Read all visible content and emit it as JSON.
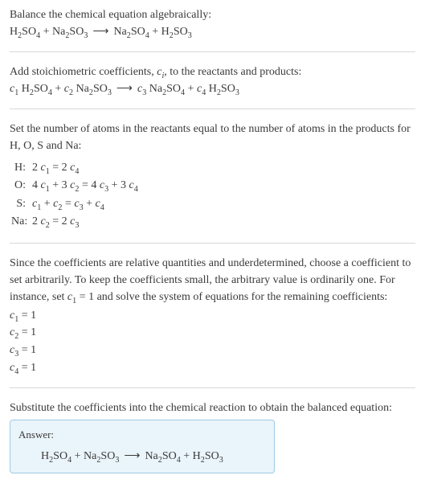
{
  "intro": {
    "line1": "Balance the chemical equation algebraically:",
    "eq_lhs1": "H",
    "eq_lhs2": "2",
    "eq_lhs3": "SO",
    "eq_lhs4": "4",
    "plus1": " + ",
    "eq_lhs5": "Na",
    "eq_lhs6": "2",
    "eq_lhs7": "SO",
    "eq_lhs8": "3",
    "arrow": "⟶",
    "eq_rhs1": "Na",
    "eq_rhs2": "2",
    "eq_rhs3": "SO",
    "eq_rhs4": "4",
    "plus2": " + ",
    "eq_rhs5": "H",
    "eq_rhs6": "2",
    "eq_rhs7": "SO",
    "eq_rhs8": "3"
  },
  "step_coeffs": {
    "text1": "Add stoichiometric coefficients, ",
    "ci_c": "c",
    "ci_i": "i",
    "text2": ", to the reactants and products:",
    "c1": "c",
    "s1": "1",
    "sp1": " H",
    "s1b": "2",
    "sp1b": "SO",
    "s1c": "4",
    "plus1": " + ",
    "c2": "c",
    "s2": "2",
    "sp2": " Na",
    "s2b": "2",
    "sp2b": "SO",
    "s2c": "3",
    "arrow": "⟶",
    "c3": "c",
    "s3": "3",
    "sp3": " Na",
    "s3b": "2",
    "sp3b": "SO",
    "s3c": "4",
    "plus2": " + ",
    "c4": "c",
    "s4": "4",
    "sp4": " H",
    "s4b": "2",
    "sp4b": "SO",
    "s4c": "3"
  },
  "step_atoms": {
    "text": "Set the number of atoms in the reactants equal to the number of atoms in the products for H, O, S and Na:",
    "rows": {
      "H_label": "H:",
      "H_eq_a": "2 ",
      "H_c1": "c",
      "H_s1": "1",
      "H_mid": " = 2 ",
      "H_c4": "c",
      "H_s4": "4",
      "O_label": "O:",
      "O_a": "4 ",
      "O_c1": "c",
      "O_s1": "1",
      "O_b": " + 3 ",
      "O_c2": "c",
      "O_s2": "2",
      "O_c": " = 4 ",
      "O_c3": "c",
      "O_s3": "3",
      "O_d": " + 3 ",
      "O_c4": "c",
      "O_s4": "4",
      "S_label": "S:",
      "S_c1": "c",
      "S_s1": "1",
      "S_a": " + ",
      "S_c2": "c",
      "S_s2": "2",
      "S_b": " = ",
      "S_c3": "c",
      "S_s3": "3",
      "S_c": " + ",
      "S_c4": "c",
      "S_s4": "4",
      "Na_label": "Na:",
      "Na_a": "2 ",
      "Na_c2": "c",
      "Na_s2": "2",
      "Na_b": " = 2 ",
      "Na_c3": "c",
      "Na_s3": "3"
    }
  },
  "step_solve": {
    "text_a": "Since the coefficients are relative quantities and underdetermined, choose a coefficient to set arbitrarily. To keep the coefficients small, the arbitrary value is ordinarily one. For instance, set ",
    "set_c": "c",
    "set_s": "1",
    "set_eq": " = 1",
    "text_b": " and solve the system of equations for the remaining coefficients:",
    "c1c": "c",
    "c1s": "1",
    "c1v": " = 1",
    "c2c": "c",
    "c2s": "2",
    "c2v": " = 1",
    "c3c": "c",
    "c3s": "3",
    "c3v": " = 1",
    "c4c": "c",
    "c4s": "4",
    "c4v": " = 1"
  },
  "step_final": {
    "text": "Substitute the coefficients into the chemical reaction to obtain the balanced equation:",
    "answer_label": "Answer:",
    "lhs1": "H",
    "lhs2": "2",
    "lhs3": "SO",
    "lhs4": "4",
    "plus1": " + ",
    "lhs5": "Na",
    "lhs6": "2",
    "lhs7": "SO",
    "lhs8": "3",
    "arrow": "⟶",
    "rhs1": "Na",
    "rhs2": "2",
    "rhs3": "SO",
    "rhs4": "4",
    "plus2": " + ",
    "rhs5": "H",
    "rhs6": "2",
    "rhs7": "SO",
    "rhs8": "3"
  }
}
